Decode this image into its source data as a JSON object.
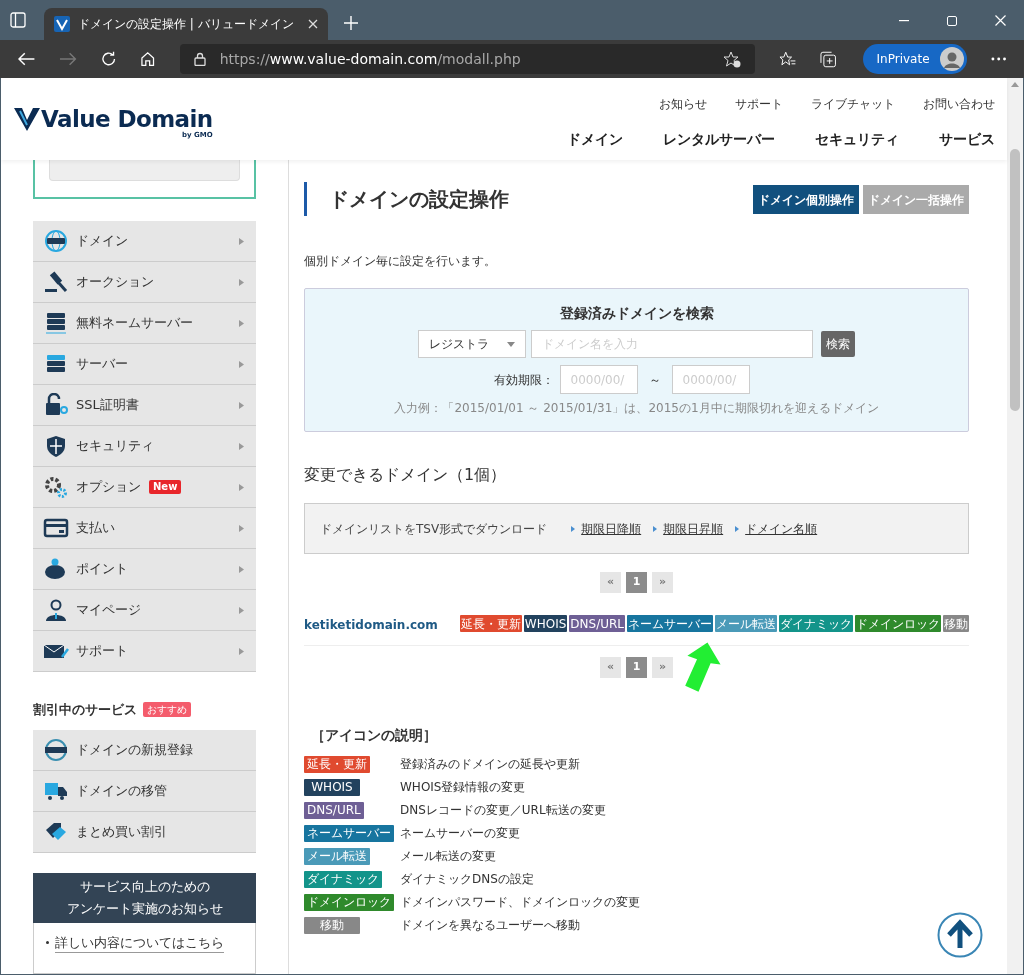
{
  "browser": {
    "tab_title": "ドメインの設定操作 | バリュードメイン",
    "url_scheme": "https://",
    "url_host": "www.value-domain.com",
    "url_path": "/modall.php",
    "profile_label": "InPrivate"
  },
  "header": {
    "logo_text": "Value Domain",
    "logo_sub": "by GMO",
    "top_links": [
      "お知らせ",
      "サポート",
      "ライブチャット",
      "お問い合わせ"
    ],
    "main_nav": [
      "ドメイン",
      "レンタルサーバー",
      "セキュリティ",
      "サービス"
    ]
  },
  "sidebar": {
    "menu": [
      {
        "label": "ドメイン"
      },
      {
        "label": "オークション"
      },
      {
        "label": "無料ネームサーバー"
      },
      {
        "label": "サーバー"
      },
      {
        "label": "SSL証明書"
      },
      {
        "label": "セキュリティ"
      },
      {
        "label": "オプション",
        "badge": "New"
      },
      {
        "label": "支払い"
      },
      {
        "label": "ポイント"
      },
      {
        "label": "マイページ"
      },
      {
        "label": "サポート"
      }
    ],
    "discount_title": "割引中のサービス",
    "discount_badge": "おすすめ",
    "discount_items": [
      "ドメインの新規登録",
      "ドメインの移管",
      "まとめ買い割引"
    ],
    "notice_title": [
      "サービス向上のための",
      "アンケート実施のお知らせ"
    ],
    "notice_links": [
      "詳しい内容についてはこちら"
    ]
  },
  "main": {
    "title": "ドメインの設定操作",
    "mode_buttons": [
      {
        "label": "ドメイン個別操作",
        "selected": true
      },
      {
        "label": "ドメイン一括操作",
        "selected": false
      }
    ],
    "description": "個別ドメイン毎に設定を行います。",
    "search": {
      "title": "登録済みドメインを検索",
      "select_value": "レジストラ",
      "domain_placeholder": "ドメイン名を入力",
      "search_button": "検索",
      "expiry_label": "有効期限：",
      "from_placeholder": "0000/00/",
      "separator": "～",
      "to_placeholder": "0000/00/",
      "hint": "入力例：「2015/01/01 ～ 2015/01/31」は、2015の1月中に期限切れを迎えるドメイン"
    },
    "list_title": "変更できるドメイン（1個）",
    "download": {
      "label": "ドメインリストをTSV形式でダウンロード",
      "links": [
        "期限日降順",
        "期限日昇順",
        "ドメイン名順"
      ]
    },
    "pagination": [
      {
        "label": "«",
        "selected": false
      },
      {
        "label": "1",
        "selected": true
      },
      {
        "label": "»",
        "selected": false
      }
    ],
    "domains": [
      {
        "name": "ketiketidomain.com",
        "tags": [
          {
            "label": "延長・更新",
            "color": "#e04a2f"
          },
          {
            "label": "WHOIS",
            "color": "#22425e"
          },
          {
            "label": "DNS/URL",
            "color": "#6e5f95"
          },
          {
            "label": "ネームサーバー",
            "color": "#17759f"
          },
          {
            "label": "メール転送",
            "color": "#4a9ab8"
          },
          {
            "label": "ダイナミック",
            "color": "#13948a"
          },
          {
            "label": "ドメインロック",
            "color": "#2f8a2c"
          },
          {
            "label": "移動",
            "color": "#888888"
          }
        ]
      }
    ],
    "pagination_bottom": [
      {
        "label": "«",
        "selected": false
      },
      {
        "label": "1",
        "selected": true
      },
      {
        "label": "»",
        "selected": false
      }
    ],
    "legend_title": "［アイコンの説明］",
    "legend": [
      {
        "tag": "延長・更新",
        "color": "#e04a2f",
        "text": "登録済みのドメインの延長や更新"
      },
      {
        "tag": "WHOIS",
        "color": "#22425e",
        "text": "WHOIS登録情報の変更"
      },
      {
        "tag": "DNS/URL",
        "color": "#6e5f95",
        "text": "DNSレコードの変更／URL転送の変更"
      },
      {
        "tag": "ネームサーバー",
        "color": "#17759f",
        "text": "ネームサーバーの変更"
      },
      {
        "tag": "メール転送",
        "color": "#4a9ab8",
        "text": "メール転送の変更"
      },
      {
        "tag": "ダイナミック",
        "color": "#13948a",
        "text": "ダイナミックDNSの設定"
      },
      {
        "tag": "ドメインロック",
        "color": "#2f8a2c",
        "text": "ドメインパスワード、ドメインロックの変更"
      },
      {
        "tag": "移動",
        "color": "#888888",
        "text": "ドメインを異なるユーザーへ移動"
      }
    ]
  }
}
